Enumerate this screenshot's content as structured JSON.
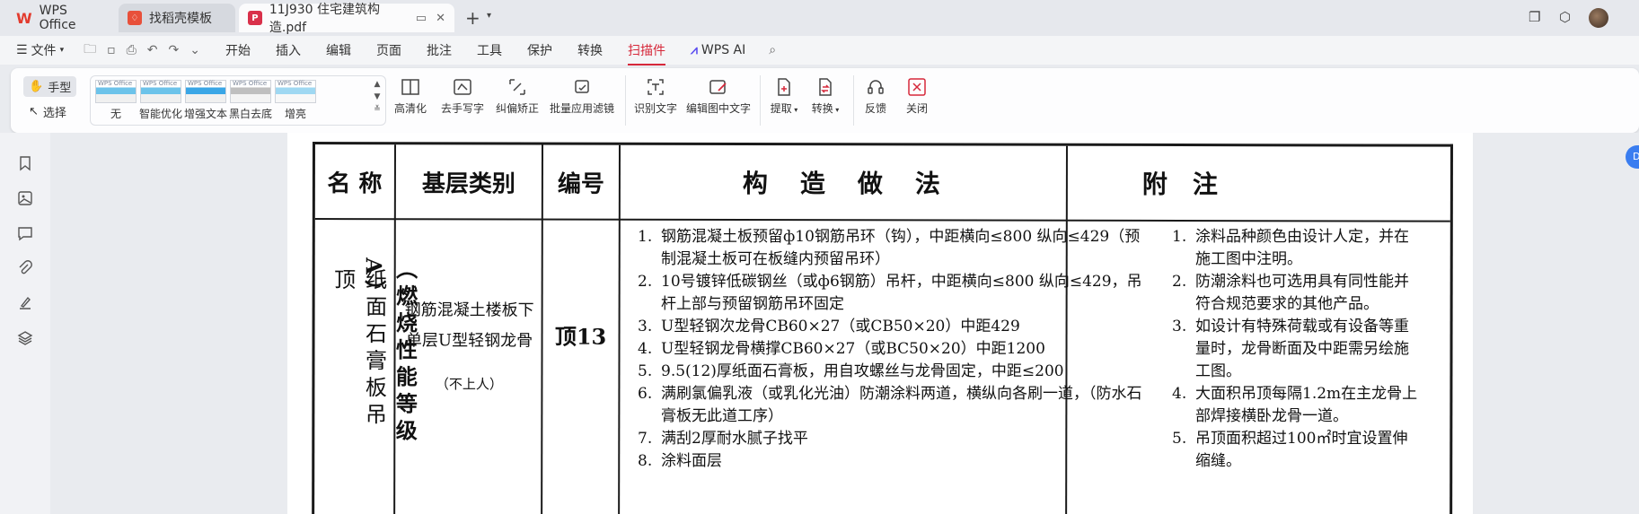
{
  "titlebar": {
    "tabs": [
      {
        "label": "WPS Office"
      },
      {
        "label": "找稻壳模板"
      },
      {
        "label": "11J930 住宅建筑构造.pdf"
      }
    ]
  },
  "menubar": {
    "file_label": "文件",
    "items": [
      "开始",
      "插入",
      "编辑",
      "页面",
      "批注",
      "工具",
      "保护",
      "转换",
      "扫描件"
    ],
    "active": "扫描件",
    "wps_ai_label": "WPS AI"
  },
  "ribbon": {
    "hand_label": "手型",
    "select_label": "选择",
    "filters": [
      "无",
      "智能优化",
      "增强文本",
      "黑白去底",
      "增亮"
    ],
    "filter_thumb_text": "WPS Office",
    "tools": [
      {
        "label": "高清化",
        "icon": "hd-icon"
      },
      {
        "label": "去手写字",
        "icon": "remove-handwriting-icon"
      },
      {
        "label": "纠偏矫正",
        "icon": "deskew-icon"
      },
      {
        "label": "批量应用滤镜",
        "icon": "batch-filter-icon"
      },
      {
        "label": "识别文字",
        "icon": "ocr-icon"
      },
      {
        "label": "编辑图中文字",
        "icon": "edit-image-text-icon"
      },
      {
        "label": "提取",
        "icon": "extract-icon",
        "dropdown": true
      },
      {
        "label": "转换",
        "icon": "convert-icon",
        "dropdown": true
      },
      {
        "label": "反馈",
        "icon": "feedback-icon"
      },
      {
        "label": "关闭",
        "icon": "close-icon"
      }
    ]
  },
  "document": {
    "headers": [
      "名 称",
      "基层类别",
      "编号",
      "构　造　做　法",
      "附　注"
    ],
    "name_main": "纸面石膏板吊顶",
    "name_sub": "（燃烧性能等级A）",
    "base_type_line1": "钢筋混凝土楼板下",
    "base_type_line2": "单层U型轻钢龙骨",
    "base_type_note": "（不上人）",
    "code": "顶13",
    "procedures": [
      {
        "n": "1.",
        "text": "钢筋混凝土板预留ф10钢筋吊环（钩），中距横向≤800 纵向≤429（预制混凝土板可在板缝内预留吊环）"
      },
      {
        "n": "2.",
        "text": "10号镀锌低碳钢丝（或ф6钢筋）吊杆，中距横向≤800 纵向≤429，吊杆上部与预留钢筋吊环固定"
      },
      {
        "n": "3.",
        "text": "U型轻钢次龙骨CB60×27（或CB50×20）中距429"
      },
      {
        "n": "4.",
        "text": "U型轻钢龙骨横撑CB60×27（或BC50×20）中距1200"
      },
      {
        "n": "5.",
        "text": "9.5(12)厚纸面石膏板，用自攻螺丝与龙骨固定，中距≤200"
      },
      {
        "n": "6.",
        "text": "满刷氯偏乳液（或乳化光油）防潮涂料两道，横纵向各刷一道，（防水石膏板无此道工序）"
      },
      {
        "n": "7.",
        "text": "满刮2厚耐水腻子找平"
      },
      {
        "n": "8.",
        "text": "涂料面层"
      }
    ],
    "notes": [
      {
        "n": "1.",
        "text": "涂料品种颜色由设计人定，并在施工图中注明。"
      },
      {
        "n": "2.",
        "text": "防潮涂料也可选用具有同性能并符合规范要求的其他产品。"
      },
      {
        "n": "3.",
        "text": "如设计有特殊荷载或有设备等重量时，龙骨断面及中距需另绘施工图。"
      },
      {
        "n": "4.",
        "text": "大面积吊顶每隔1.2m在主龙骨上部焊接横卧龙骨一道。"
      },
      {
        "n": "5.",
        "text": "吊顶面积超过100㎡时宜设置伸缩缝。"
      }
    ]
  },
  "colors": {
    "accent": "#d6283a",
    "ai_purple": "#5b4df0"
  }
}
